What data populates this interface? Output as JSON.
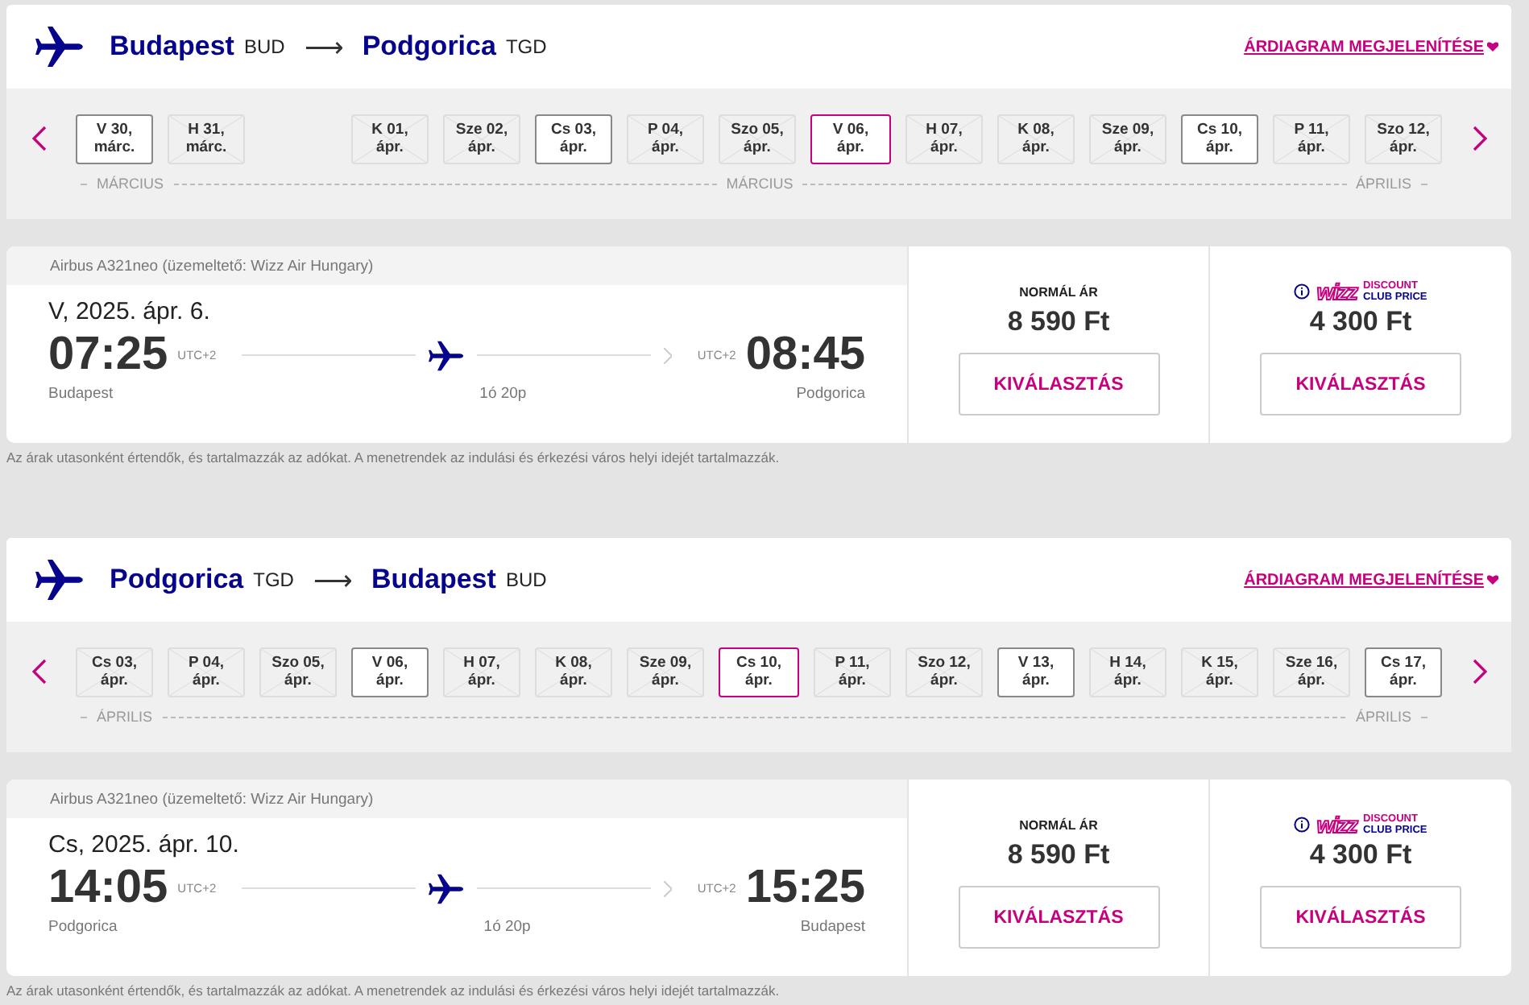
{
  "sections": [
    {
      "header": {
        "from_city": "Budapest",
        "from_code": "BUD",
        "arrow": "⟶",
        "to_city": "Podgorica",
        "to_code": "TGD",
        "chart_link": "ÁRDIAGRAM MEGJELENÍTÉSE"
      },
      "dates": [
        {
          "day": "V 30,",
          "month": "márc.",
          "available": true,
          "selected": false
        },
        {
          "day": "H 31,",
          "month": "márc.",
          "available": false,
          "selected": false
        },
        {
          "day": "K 01,",
          "month": "ápr.",
          "available": false,
          "selected": false,
          "gap_before": true
        },
        {
          "day": "Sze 02,",
          "month": "ápr.",
          "available": false,
          "selected": false
        },
        {
          "day": "Cs 03,",
          "month": "ápr.",
          "available": true,
          "selected": false
        },
        {
          "day": "P 04,",
          "month": "ápr.",
          "available": false,
          "selected": false
        },
        {
          "day": "Szo 05,",
          "month": "ápr.",
          "available": false,
          "selected": false
        },
        {
          "day": "V 06,",
          "month": "ápr.",
          "available": true,
          "selected": true
        },
        {
          "day": "H 07,",
          "month": "ápr.",
          "available": false,
          "selected": false
        },
        {
          "day": "K 08,",
          "month": "ápr.",
          "available": false,
          "selected": false
        },
        {
          "day": "Sze 09,",
          "month": "ápr.",
          "available": false,
          "selected": false
        },
        {
          "day": "Cs 10,",
          "month": "ápr.",
          "available": true,
          "selected": false
        },
        {
          "day": "P 11,",
          "month": "ápr.",
          "available": false,
          "selected": false
        },
        {
          "day": "Szo 12,",
          "month": "ápr.",
          "available": false,
          "selected": false
        }
      ],
      "months": [
        "MÁRCIUS",
        "MÁRCIUS",
        "ÁPRILIS"
      ],
      "flight": {
        "aircraft": "Airbus A321neo (üzemeltető: Wizz Air Hungary)",
        "date": "V, 2025. ápr. 6.",
        "dep_time": "07:25",
        "dep_tz": "UTC+2",
        "arr_tz": "UTC+2",
        "arr_time": "08:45",
        "dep_city": "Budapest",
        "arr_city": "Podgorica",
        "duration": "1ó 20p",
        "fares": [
          {
            "kind": "normal",
            "label": "NORMÁL ÁR",
            "price": "8 590 Ft",
            "button": "KIVÁLASZTÁS"
          },
          {
            "kind": "club",
            "logo": "wizz",
            "badge_top": "DISCOUNT",
            "badge_bottom": "CLUB PRICE",
            "price": "4 300 Ft",
            "button": "KIVÁLASZTÁS"
          }
        ]
      },
      "footnote": "Az árak utasonként értendők, és tartalmazzák az adókat. A menetrendek az indulási és érkezési város helyi idejét tartalmazzák."
    },
    {
      "header": {
        "from_city": "Podgorica",
        "from_code": "TGD",
        "arrow": "⟶",
        "to_city": "Budapest",
        "to_code": "BUD",
        "chart_link": "ÁRDIAGRAM MEGJELENÍTÉSE"
      },
      "dates": [
        {
          "day": "Cs 03,",
          "month": "ápr.",
          "available": false,
          "selected": false
        },
        {
          "day": "P 04,",
          "month": "ápr.",
          "available": false,
          "selected": false
        },
        {
          "day": "Szo 05,",
          "month": "ápr.",
          "available": false,
          "selected": false
        },
        {
          "day": "V 06,",
          "month": "ápr.",
          "available": true,
          "selected": false
        },
        {
          "day": "H 07,",
          "month": "ápr.",
          "available": false,
          "selected": false
        },
        {
          "day": "K 08,",
          "month": "ápr.",
          "available": false,
          "selected": false
        },
        {
          "day": "Sze 09,",
          "month": "ápr.",
          "available": false,
          "selected": false
        },
        {
          "day": "Cs 10,",
          "month": "ápr.",
          "available": true,
          "selected": true
        },
        {
          "day": "P 11,",
          "month": "ápr.",
          "available": false,
          "selected": false
        },
        {
          "day": "Szo 12,",
          "month": "ápr.",
          "available": false,
          "selected": false
        },
        {
          "day": "V 13,",
          "month": "ápr.",
          "available": true,
          "selected": false
        },
        {
          "day": "H 14,",
          "month": "ápr.",
          "available": false,
          "selected": false
        },
        {
          "day": "K 15,",
          "month": "ápr.",
          "available": false,
          "selected": false
        },
        {
          "day": "Sze 16,",
          "month": "ápr.",
          "available": false,
          "selected": false
        },
        {
          "day": "Cs 17,",
          "month": "ápr.",
          "available": true,
          "selected": false
        }
      ],
      "months": [
        "ÁPRILIS",
        "ÁPRILIS"
      ],
      "flight": {
        "aircraft": "Airbus A321neo (üzemeltető: Wizz Air Hungary)",
        "date": "Cs, 2025. ápr. 10.",
        "dep_time": "14:05",
        "dep_tz": "UTC+2",
        "arr_tz": "UTC+2",
        "arr_time": "15:25",
        "dep_city": "Podgorica",
        "arr_city": "Budapest",
        "duration": "1ó 20p",
        "fares": [
          {
            "kind": "normal",
            "label": "NORMÁL ÁR",
            "price": "8 590 Ft",
            "button": "KIVÁLASZTÁS"
          },
          {
            "kind": "club",
            "logo": "wizz",
            "badge_top": "DISCOUNT",
            "badge_bottom": "CLUB PRICE",
            "price": "4 300 Ft",
            "button": "KIVÁLASZTÁS"
          }
        ]
      },
      "footnote": "Az árak utasonként értendők, és tartalmazzák az adókat. A menetrendek az indulási és érkezési város helyi idejét tartalmazzák."
    }
  ]
}
